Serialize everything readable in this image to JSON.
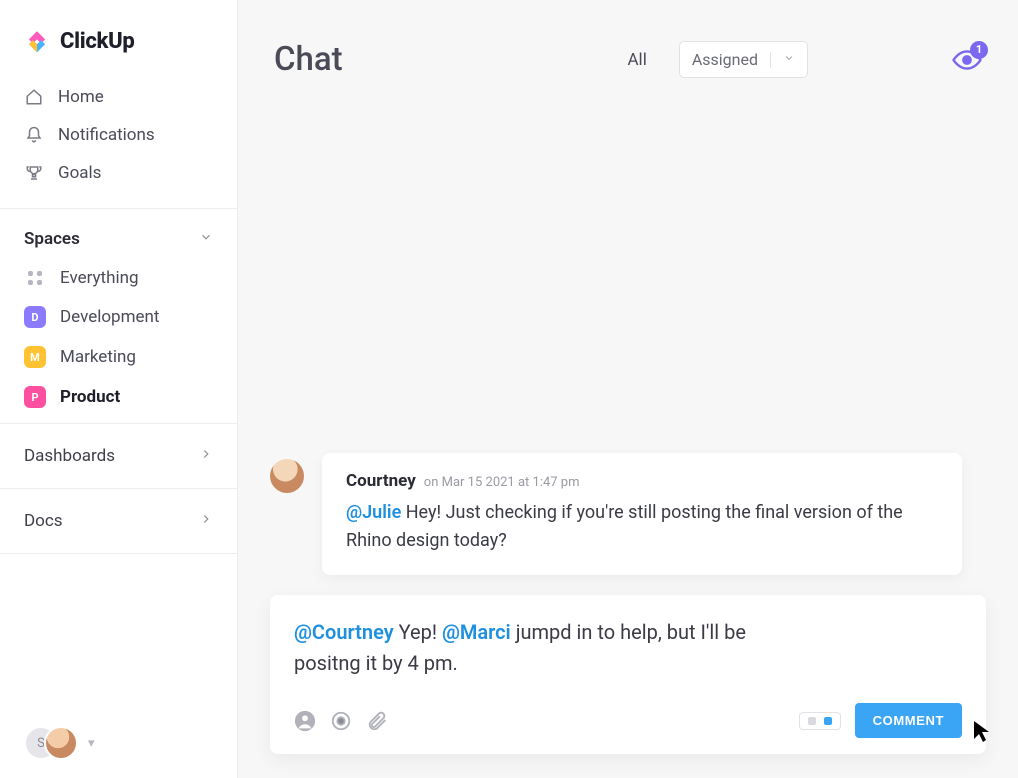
{
  "brand": {
    "name": "ClickUp"
  },
  "sidebar": {
    "nav": [
      {
        "icon": "home-icon",
        "label": "Home"
      },
      {
        "icon": "bell-icon",
        "label": "Notifications"
      },
      {
        "icon": "trophy-icon",
        "label": "Goals"
      }
    ],
    "spaces_label": "Spaces",
    "everything_label": "Everything",
    "spaces": [
      {
        "letter": "D",
        "label": "Development",
        "color": "#8d7bff",
        "active": false
      },
      {
        "letter": "M",
        "label": "Marketing",
        "color": "#ffc233",
        "active": false
      },
      {
        "letter": "P",
        "label": "Product",
        "color": "#ff4fa0",
        "active": true
      }
    ],
    "sections": [
      {
        "label": "Dashboards"
      },
      {
        "label": "Docs"
      }
    ],
    "user_initial": "S"
  },
  "chat": {
    "title": "Chat",
    "filter_all": "All",
    "filter_dropdown": "Assigned",
    "watchers_count": "1",
    "message": {
      "author": "Courtney",
      "time_prefix": "on ",
      "time": "Mar 15 2021 at 1:47 pm",
      "mention": "@Julie",
      "body_rest": " Hey! Just checking if you're still posting the final version of the Rhino design today?"
    },
    "compose": {
      "mention1": "@Courtney",
      "seg1": " Yep! ",
      "mention2": "@Marci",
      "seg2": " jumpd in to help, but I'll be positng it by 4 pm.",
      "button": "COMMENT"
    }
  }
}
